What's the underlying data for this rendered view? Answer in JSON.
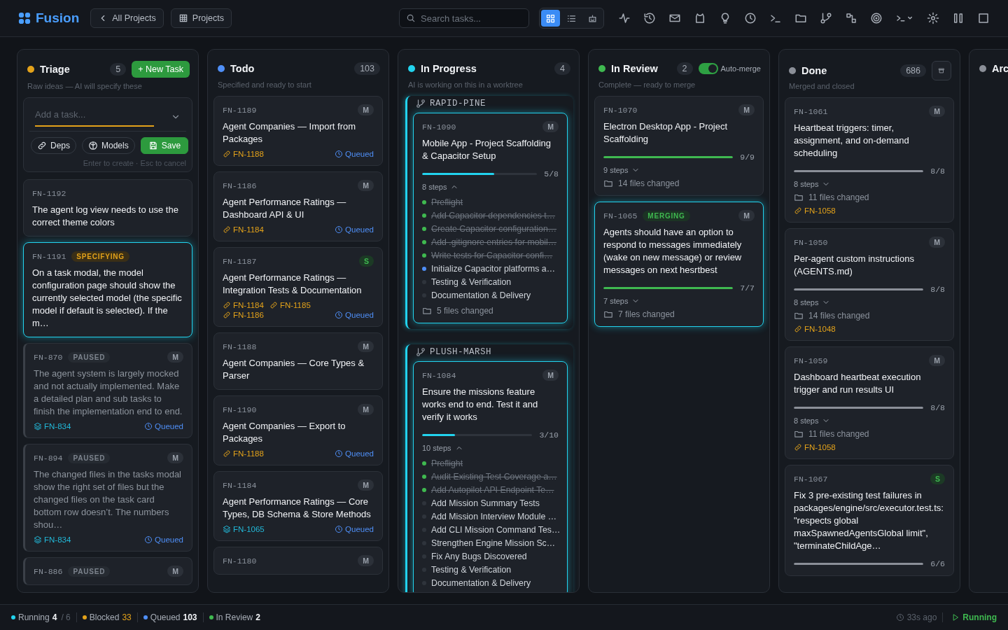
{
  "topbar": {
    "logo": "Fusion",
    "back_button": "All Projects",
    "projects_button": "Projects",
    "search": {
      "placeholder": "Search tasks..."
    },
    "view_modes": [
      {
        "kind": "board",
        "selected": true
      },
      {
        "kind": "list",
        "selected": false
      },
      {
        "kind": "agents",
        "selected": false
      }
    ]
  },
  "columns": [
    {
      "title": "Triage",
      "color": "#e3a21a",
      "count": "5",
      "subtitle": "Raw ideas — AI will specify these",
      "new_task_button": "+ New Task",
      "composer": {
        "placeholder": "Add a task...",
        "buttons": [
          {
            "label": "Deps",
            "kind": "deps"
          },
          {
            "label": "Models",
            "kind": "models"
          },
          {
            "label": "Save",
            "kind": "save"
          }
        ],
        "hint": "Enter to create · Esc to cancel"
      },
      "cards": [
        {
          "id": "FN-1192",
          "title": "The agent log view needs to use the correct theme colors",
          "highlighted": false
        },
        {
          "id": "FN-1191",
          "badge": {
            "text": "SPECIFYING",
            "kind": "specifying"
          },
          "title": "On a task modal, the model configuration page should show the currently selected model (the specific model if default is selected). If the m…",
          "highlighted": true
        },
        {
          "id": "FN-870",
          "badge": {
            "text": "PAUSED",
            "kind": "paused"
          },
          "size": {
            "label": "M",
            "kind": "medium"
          },
          "title": "The agent system is largely mocked and not actually implemented. Make a detailed plan and sub tasks to finish the implementation end to end.",
          "deps": [
            {
              "id": "FN-834",
              "kind": "parent"
            }
          ],
          "status": "Queued",
          "highlighted": false
        },
        {
          "id": "FN-894",
          "badge": {
            "text": "PAUSED",
            "kind": "paused"
          },
          "size": {
            "label": "M",
            "kind": "medium"
          },
          "title": "The changed files in the tasks modal show the right set of files but the changed files on the task card bottom row doesn’t. The numbers shou…",
          "deps": [
            {
              "id": "FN-834",
              "kind": "parent"
            }
          ],
          "status": "Queued",
          "highlighted": false
        },
        {
          "id": "FN-886",
          "badge": {
            "text": "PAUSED",
            "kind": "paused"
          },
          "size": {
            "label": "M",
            "kind": "medium"
          },
          "highlighted": false
        }
      ]
    },
    {
      "title": "Todo",
      "color": "#4f8ff7",
      "count": "103",
      "subtitle": "Specified and ready to start",
      "cards": [
        {
          "id": "FN-1189",
          "size": {
            "label": "M",
            "kind": "medium"
          },
          "title": "Agent Companies — Import from Packages",
          "deps": [
            {
              "id": "FN-1188",
              "kind": "blocker"
            }
          ],
          "status": "Queued",
          "highlighted": false
        },
        {
          "id": "FN-1186",
          "size": {
            "label": "M",
            "kind": "medium"
          },
          "title": "Agent Performance Ratings — Dashboard API & UI",
          "deps": [
            {
              "id": "FN-1184",
              "kind": "blocker"
            }
          ],
          "status": "Queued",
          "highlighted": false
        },
        {
          "id": "FN-1187",
          "size": {
            "label": "S",
            "kind": "small"
          },
          "title": "Agent Performance Ratings — Integration Tests & Documentation",
          "deps": [
            {
              "id": "FN-1184",
              "kind": "blocker"
            },
            {
              "id": "FN-1185",
              "kind": "blocker"
            },
            {
              "id": "FN-1186",
              "kind": "blocker"
            }
          ],
          "status": "Queued",
          "highlighted": false
        },
        {
          "id": "FN-1188",
          "size": {
            "label": "M",
            "kind": "medium"
          },
          "title": "Agent Companies — Core Types & Parser",
          "highlighted": false
        },
        {
          "id": "FN-1190",
          "size": {
            "label": "M",
            "kind": "medium"
          },
          "title": "Agent Companies — Export to Packages",
          "deps": [
            {
              "id": "FN-1188",
              "kind": "blocker"
            }
          ],
          "status": "Queued",
          "highlighted": false
        },
        {
          "id": "FN-1184",
          "size": {
            "label": "M",
            "kind": "medium"
          },
          "title": "Agent Performance Ratings — Core Types, DB Schema & Store Methods",
          "deps": [
            {
              "id": "FN-1065",
              "kind": "parent"
            }
          ],
          "status": "Queued",
          "highlighted": false
        },
        {
          "id": "FN-1180",
          "size": {
            "label": "M",
            "kind": "medium"
          },
          "highlighted": false
        }
      ]
    },
    {
      "title": "In Progress",
      "color": "#22d3ee",
      "count": "4",
      "subtitle": "AI is working on this in a worktree",
      "worktrees": [
        {
          "name": "RAPID-PINE",
          "cards": [
            {
              "id": "FN-1090",
              "size": {
                "label": "M",
                "kind": "medium"
              },
              "title": "Mobile App - Project Scaffolding & Capacitor Setup",
              "progress": {
                "level": 0.625,
                "label": "5/8"
              },
              "steps_label": "8 steps",
              "expanded": true,
              "steps": [
                {
                  "text": "Preflight",
                  "done": true,
                  "current": false
                },
                {
                  "text": "Add Capacitor dependencies t…",
                  "done": true,
                  "current": false
                },
                {
                  "text": "Create Capacitor configuration…",
                  "done": true,
                  "current": false
                },
                {
                  "text": "Add .gitignore entries for mobil…",
                  "done": true,
                  "current": false
                },
                {
                  "text": "Write tests for Capacitor confi…",
                  "done": true,
                  "current": false
                },
                {
                  "text": "Initialize Capacitor platforms a…",
                  "done": false,
                  "current": true
                },
                {
                  "text": "Testing & Verification",
                  "done": false,
                  "current": false
                },
                {
                  "text": "Documentation & Delivery",
                  "done": false,
                  "current": false
                }
              ],
              "files": "5 files changed",
              "highlighted": true
            }
          ]
        },
        {
          "name": "PLUSH-MARSH",
          "cards": [
            {
              "id": "FN-1084",
              "size": {
                "label": "M",
                "kind": "medium"
              },
              "title": "Ensure the missions feature works end to end. Test it and verify it works",
              "progress": {
                "level": 0.3,
                "label": "3/10"
              },
              "steps_label": "10 steps",
              "expanded": true,
              "steps": [
                {
                  "text": "Preflight",
                  "done": true,
                  "current": false
                },
                {
                  "text": "Audit Existing Test Coverage a…",
                  "done": true,
                  "current": false
                },
                {
                  "text": "Add Autopilot API Endpoint Te…",
                  "done": true,
                  "current": false
                },
                {
                  "text": "Add Mission Summary Tests",
                  "done": false,
                  "current": false
                },
                {
                  "text": "Add Mission Interview Module …",
                  "done": false,
                  "current": false
                },
                {
                  "text": "Add CLI Mission Command Tes…",
                  "done": false,
                  "current": false
                },
                {
                  "text": "Strengthen Engine Mission Sc…",
                  "done": false,
                  "current": false
                },
                {
                  "text": "Fix Any Bugs Discovered",
                  "done": false,
                  "current": false
                },
                {
                  "text": "Testing & Verification",
                  "done": false,
                  "current": false
                },
                {
                  "text": "Documentation & Delivery",
                  "done": false,
                  "current": false
                }
              ],
              "highlighted": true
            }
          ]
        }
      ]
    },
    {
      "title": "In Review",
      "color": "#3fb950",
      "count": "2",
      "subtitle": "Complete — ready to merge",
      "auto_merge": {
        "label": "Auto-merge",
        "on": true
      },
      "cards": [
        {
          "id": "FN-1070",
          "size": {
            "label": "M",
            "kind": "medium"
          },
          "title": "Electron Desktop App - Project Scaffolding",
          "progress": {
            "level": 1,
            "label": "9/9"
          },
          "steps_label": "9 steps",
          "expanded": false,
          "files": "14 files changed",
          "highlighted": false
        },
        {
          "id": "FN-1065",
          "badge": {
            "text": "MERGING",
            "kind": "merging"
          },
          "size": {
            "label": "M",
            "kind": "medium"
          },
          "title": "Agents should have an option to respond to messages immediately (wake on new message) or review messages on next hesrtbest",
          "progress": {
            "level": 1,
            "label": "7/7"
          },
          "steps_label": "7 steps",
          "expanded": false,
          "files": "7 files changed",
          "highlighted": true
        }
      ]
    },
    {
      "title": "Done",
      "color": "#8b8f98",
      "count": "686",
      "subtitle": "Merged and closed",
      "archive_button": true,
      "cards": [
        {
          "id": "FN-1061",
          "size": {
            "label": "M",
            "kind": "medium"
          },
          "title": "Heartbeat triggers: timer, assignment, and on-demand scheduling",
          "progress": {
            "level": 1,
            "label": "8/8"
          },
          "steps_label": "8 steps",
          "expanded": false,
          "files": "11 files changed",
          "deps": [
            {
              "id": "FN-1058",
              "kind": "blocker"
            }
          ],
          "highlighted": false
        },
        {
          "id": "FN-1050",
          "size": {
            "label": "M",
            "kind": "medium"
          },
          "title": "Per-agent custom instructions (AGENTS.md)",
          "progress": {
            "level": 1,
            "label": "8/8"
          },
          "steps_label": "8 steps",
          "expanded": false,
          "files": "14 files changed",
          "deps": [
            {
              "id": "FN-1048",
              "kind": "blocker"
            }
          ],
          "highlighted": false
        },
        {
          "id": "FN-1059",
          "size": {
            "label": "M",
            "kind": "medium"
          },
          "title": "Dashboard heartbeat execution trigger and run results UI",
          "progress": {
            "level": 1,
            "label": "8/8"
          },
          "steps_label": "8 steps",
          "expanded": false,
          "files": "11 files changed",
          "deps": [
            {
              "id": "FN-1058",
              "kind": "blocker"
            }
          ],
          "highlighted": false
        },
        {
          "id": "FN-1067",
          "size": {
            "label": "S",
            "kind": "small"
          },
          "title": "Fix 3 pre-existing test failures in packages/engine/src/executor.test.ts: \"respects global maxSpawnedAgentsGlobal limit\", \"terminateChildAge…",
          "progress": {
            "level": 1,
            "label": "6/6"
          },
          "highlighted": false
        }
      ]
    },
    {
      "title": "Arc",
      "color": "#8b8f98"
    }
  ],
  "status_bar": {
    "items": [
      {
        "label": "Running",
        "value": "4",
        "suffix": "/ 6",
        "color": "#22d3ee",
        "warn": false
      },
      {
        "label": "Blocked",
        "value": "33",
        "color": "#e3a21a",
        "warn": true
      },
      {
        "label": "Queued",
        "value": "103",
        "color": "#4f8ff7",
        "warn": false
      },
      {
        "label": "In Review",
        "value": "2",
        "color": "#3fb950",
        "warn": false
      }
    ],
    "updated": "33s ago",
    "engine": "Running"
  }
}
